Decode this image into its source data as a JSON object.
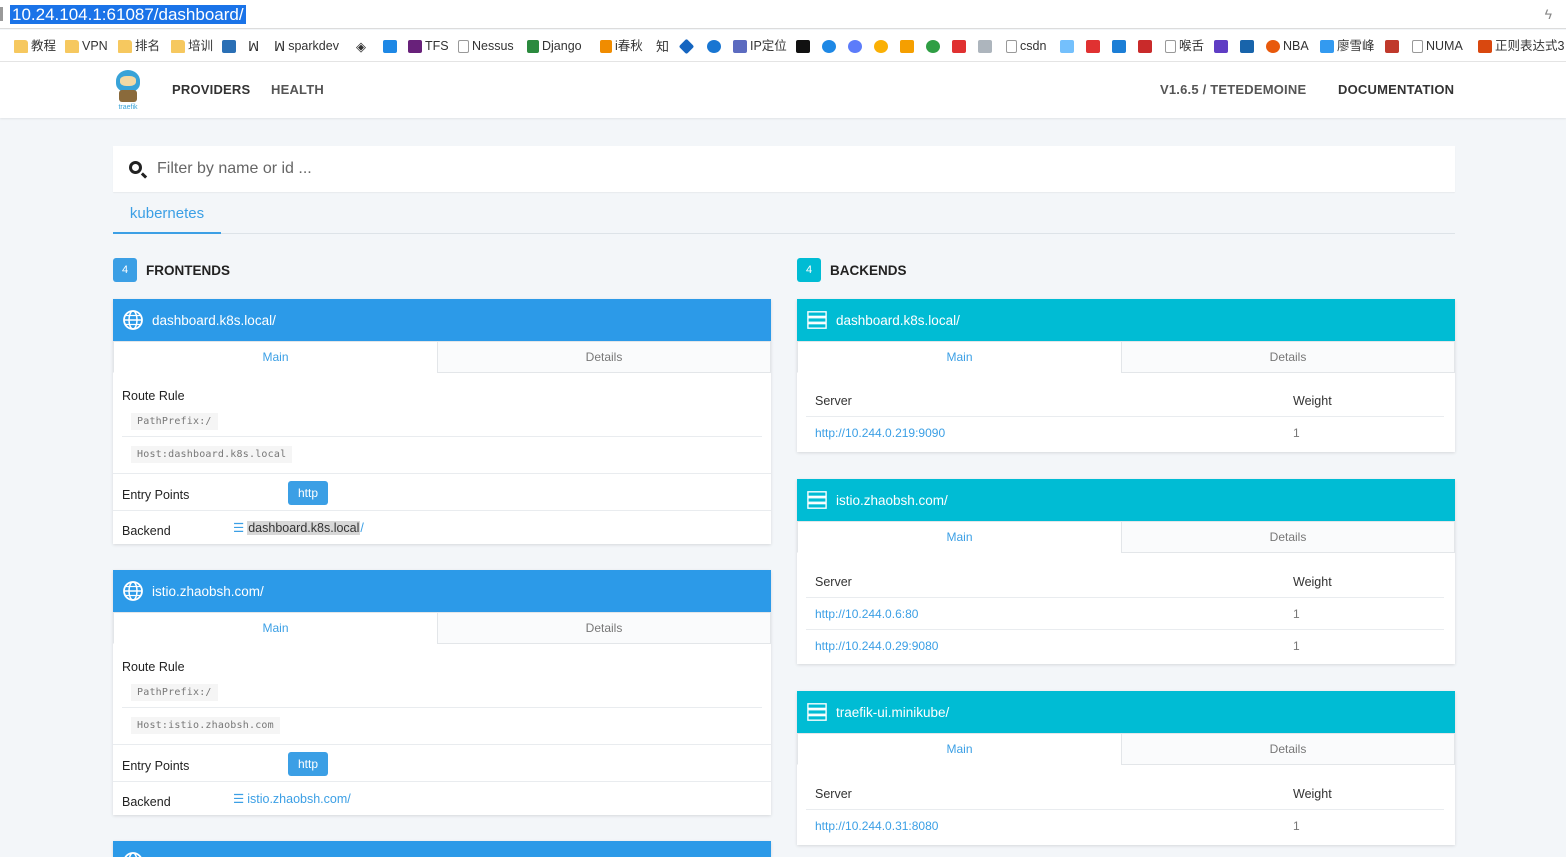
{
  "browser": {
    "url": "10.24.104.1:61087/dashboard/",
    "bookmarks": [
      {
        "label": "教程",
        "icon": "folder-icon"
      },
      {
        "label": "VPN",
        "icon": "folder-icon"
      },
      {
        "label": "排名",
        "icon": "folder-icon"
      },
      {
        "label": "培训",
        "icon": "folder-icon"
      },
      {
        "label": "",
        "icon": "gs-icon"
      },
      {
        "label": "",
        "icon": "feather-icon"
      },
      {
        "label": "sparkdev",
        "icon": "feather-icon"
      },
      {
        "label": "",
        "icon": "diamond-icon"
      },
      {
        "label": "",
        "icon": "star-badge-icon"
      },
      {
        "label": "TFS",
        "icon": "vs-icon"
      },
      {
        "label": "Nessus",
        "icon": "page-icon"
      },
      {
        "label": "Django",
        "icon": "django-icon"
      },
      {
        "label": "i春秋",
        "icon": "ichunqiu-icon"
      },
      {
        "label": "",
        "icon": "zhi-icon"
      },
      {
        "label": "",
        "icon": "cube-icon"
      },
      {
        "label": "",
        "icon": "e-icon"
      },
      {
        "label": "IP定位",
        "icon": "ip-icon"
      },
      {
        "label": "",
        "icon": "n-icon"
      },
      {
        "label": "",
        "icon": "u-icon"
      },
      {
        "label": "",
        "icon": "dots-icon"
      },
      {
        "label": "",
        "icon": "coin-icon"
      },
      {
        "label": "",
        "icon": "stack-icon"
      },
      {
        "label": "",
        "icon": "c-icon"
      },
      {
        "label": "",
        "icon": "oracle-icon"
      },
      {
        "label": "",
        "icon": "tool-icon"
      },
      {
        "label": "csdn",
        "icon": "page-icon"
      },
      {
        "label": "",
        "icon": "info-icon"
      },
      {
        "label": "",
        "icon": "z-icon"
      },
      {
        "label": "",
        "icon": "zhihu-icon"
      },
      {
        "label": "",
        "icon": "tiger-icon"
      },
      {
        "label": "喉舌",
        "icon": "page-icon"
      },
      {
        "label": "",
        "icon": "6v-icon"
      },
      {
        "label": "",
        "icon": "bus-icon"
      },
      {
        "label": "NBA",
        "icon": "weibo-icon"
      },
      {
        "label": "廖雪峰",
        "icon": "rocket-icon"
      },
      {
        "label": "",
        "icon": "jian-icon"
      },
      {
        "label": "NUMA",
        "icon": "page-icon"
      },
      {
        "label": "正则表达式3",
        "icon": "regex-icon"
      }
    ]
  },
  "nav": {
    "providers": "PROVIDERS",
    "health": "HEALTH",
    "version": "V1.6.5 / TETEDEMOINE",
    "documentation": "DOCUMENTATION",
    "logo_text": "traefik"
  },
  "search": {
    "placeholder": "Filter by name or id ..."
  },
  "provider_tab": "kubernetes",
  "frontends": {
    "count": "4",
    "title": "FRONTENDS",
    "cards": [
      {
        "name": "dashboard.k8s.local/",
        "tab_main": "Main",
        "tab_details": "Details",
        "route_rule_label": "Route Rule",
        "rules": [
          "PathPrefix:/",
          "Host:dashboard.k8s.local"
        ],
        "entry_points_label": "Entry Points",
        "entry_point": "http",
        "backend_label": "Backend",
        "backend_name": "dashboard.k8s.local",
        "backend_suffix": "/"
      },
      {
        "name": "istio.zhaobsh.com/",
        "tab_main": "Main",
        "tab_details": "Details",
        "route_rule_label": "Route Rule",
        "rules": [
          "PathPrefix:/",
          "Host:istio.zhaobsh.com"
        ],
        "entry_points_label": "Entry Points",
        "entry_point": "http",
        "backend_label": "Backend",
        "backend_name": "istio.zhaobsh.com/",
        "backend_suffix": ""
      }
    ]
  },
  "backends": {
    "count": "4",
    "title": "BACKENDS",
    "cards": [
      {
        "name": "dashboard.k8s.local/",
        "tab_main": "Main",
        "tab_details": "Details",
        "server_label": "Server",
        "weight_label": "Weight",
        "servers": [
          {
            "url": "http://10.244.0.219:9090",
            "weight": "1"
          }
        ]
      },
      {
        "name": "istio.zhaobsh.com/",
        "tab_main": "Main",
        "tab_details": "Details",
        "server_label": "Server",
        "weight_label": "Weight",
        "servers": [
          {
            "url": "http://10.244.0.6:80",
            "weight": "1"
          },
          {
            "url": "http://10.244.0.29:9080",
            "weight": "1"
          }
        ]
      },
      {
        "name": "traefik-ui.minikube/",
        "tab_main": "Main",
        "tab_details": "Details",
        "server_label": "Server",
        "weight_label": "Weight",
        "servers": [
          {
            "url": "http://10.244.0.31:8080",
            "weight": "1"
          }
        ]
      }
    ]
  },
  "colors": {
    "frontend_header": "#2c9ae8",
    "backend_header": "#00bcd4",
    "link": "#3b9fe5",
    "page_bg": "#f3f6f9"
  }
}
